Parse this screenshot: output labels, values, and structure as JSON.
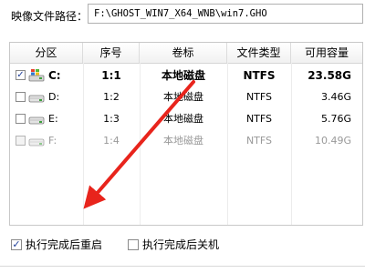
{
  "path": {
    "label": "映像文件路径：",
    "value": "F:\\GHOST_WIN7_X64_WNB\\win7.GHO"
  },
  "table": {
    "columns": [
      "分区",
      "序号",
      "卷标",
      "文件类型",
      "可用容量"
    ],
    "rows": [
      {
        "checked": true,
        "letter": "C:",
        "index": "1:1",
        "label": "本地磁盘",
        "fs": "NTFS",
        "free": "23.58G",
        "state": "selected"
      },
      {
        "checked": false,
        "letter": "D:",
        "index": "1:2",
        "label": "本地磁盘",
        "fs": "NTFS",
        "free": "3.46G",
        "state": "normal"
      },
      {
        "checked": false,
        "letter": "E:",
        "index": "1:3",
        "label": "本地磁盘",
        "fs": "NTFS",
        "free": "5.76G",
        "state": "normal"
      },
      {
        "checked": false,
        "letter": "F:",
        "index": "1:4",
        "label": "本地磁盘",
        "fs": "NTFS",
        "free": "10.49G",
        "state": "disabled"
      }
    ]
  },
  "options": {
    "reboot": {
      "label": "执行完成后重启",
      "checked": true
    },
    "shutdown": {
      "label": "执行完成后关机",
      "checked": false
    }
  },
  "colors": {
    "annotation_arrow": "#e8241c"
  },
  "check_mark": "✓"
}
